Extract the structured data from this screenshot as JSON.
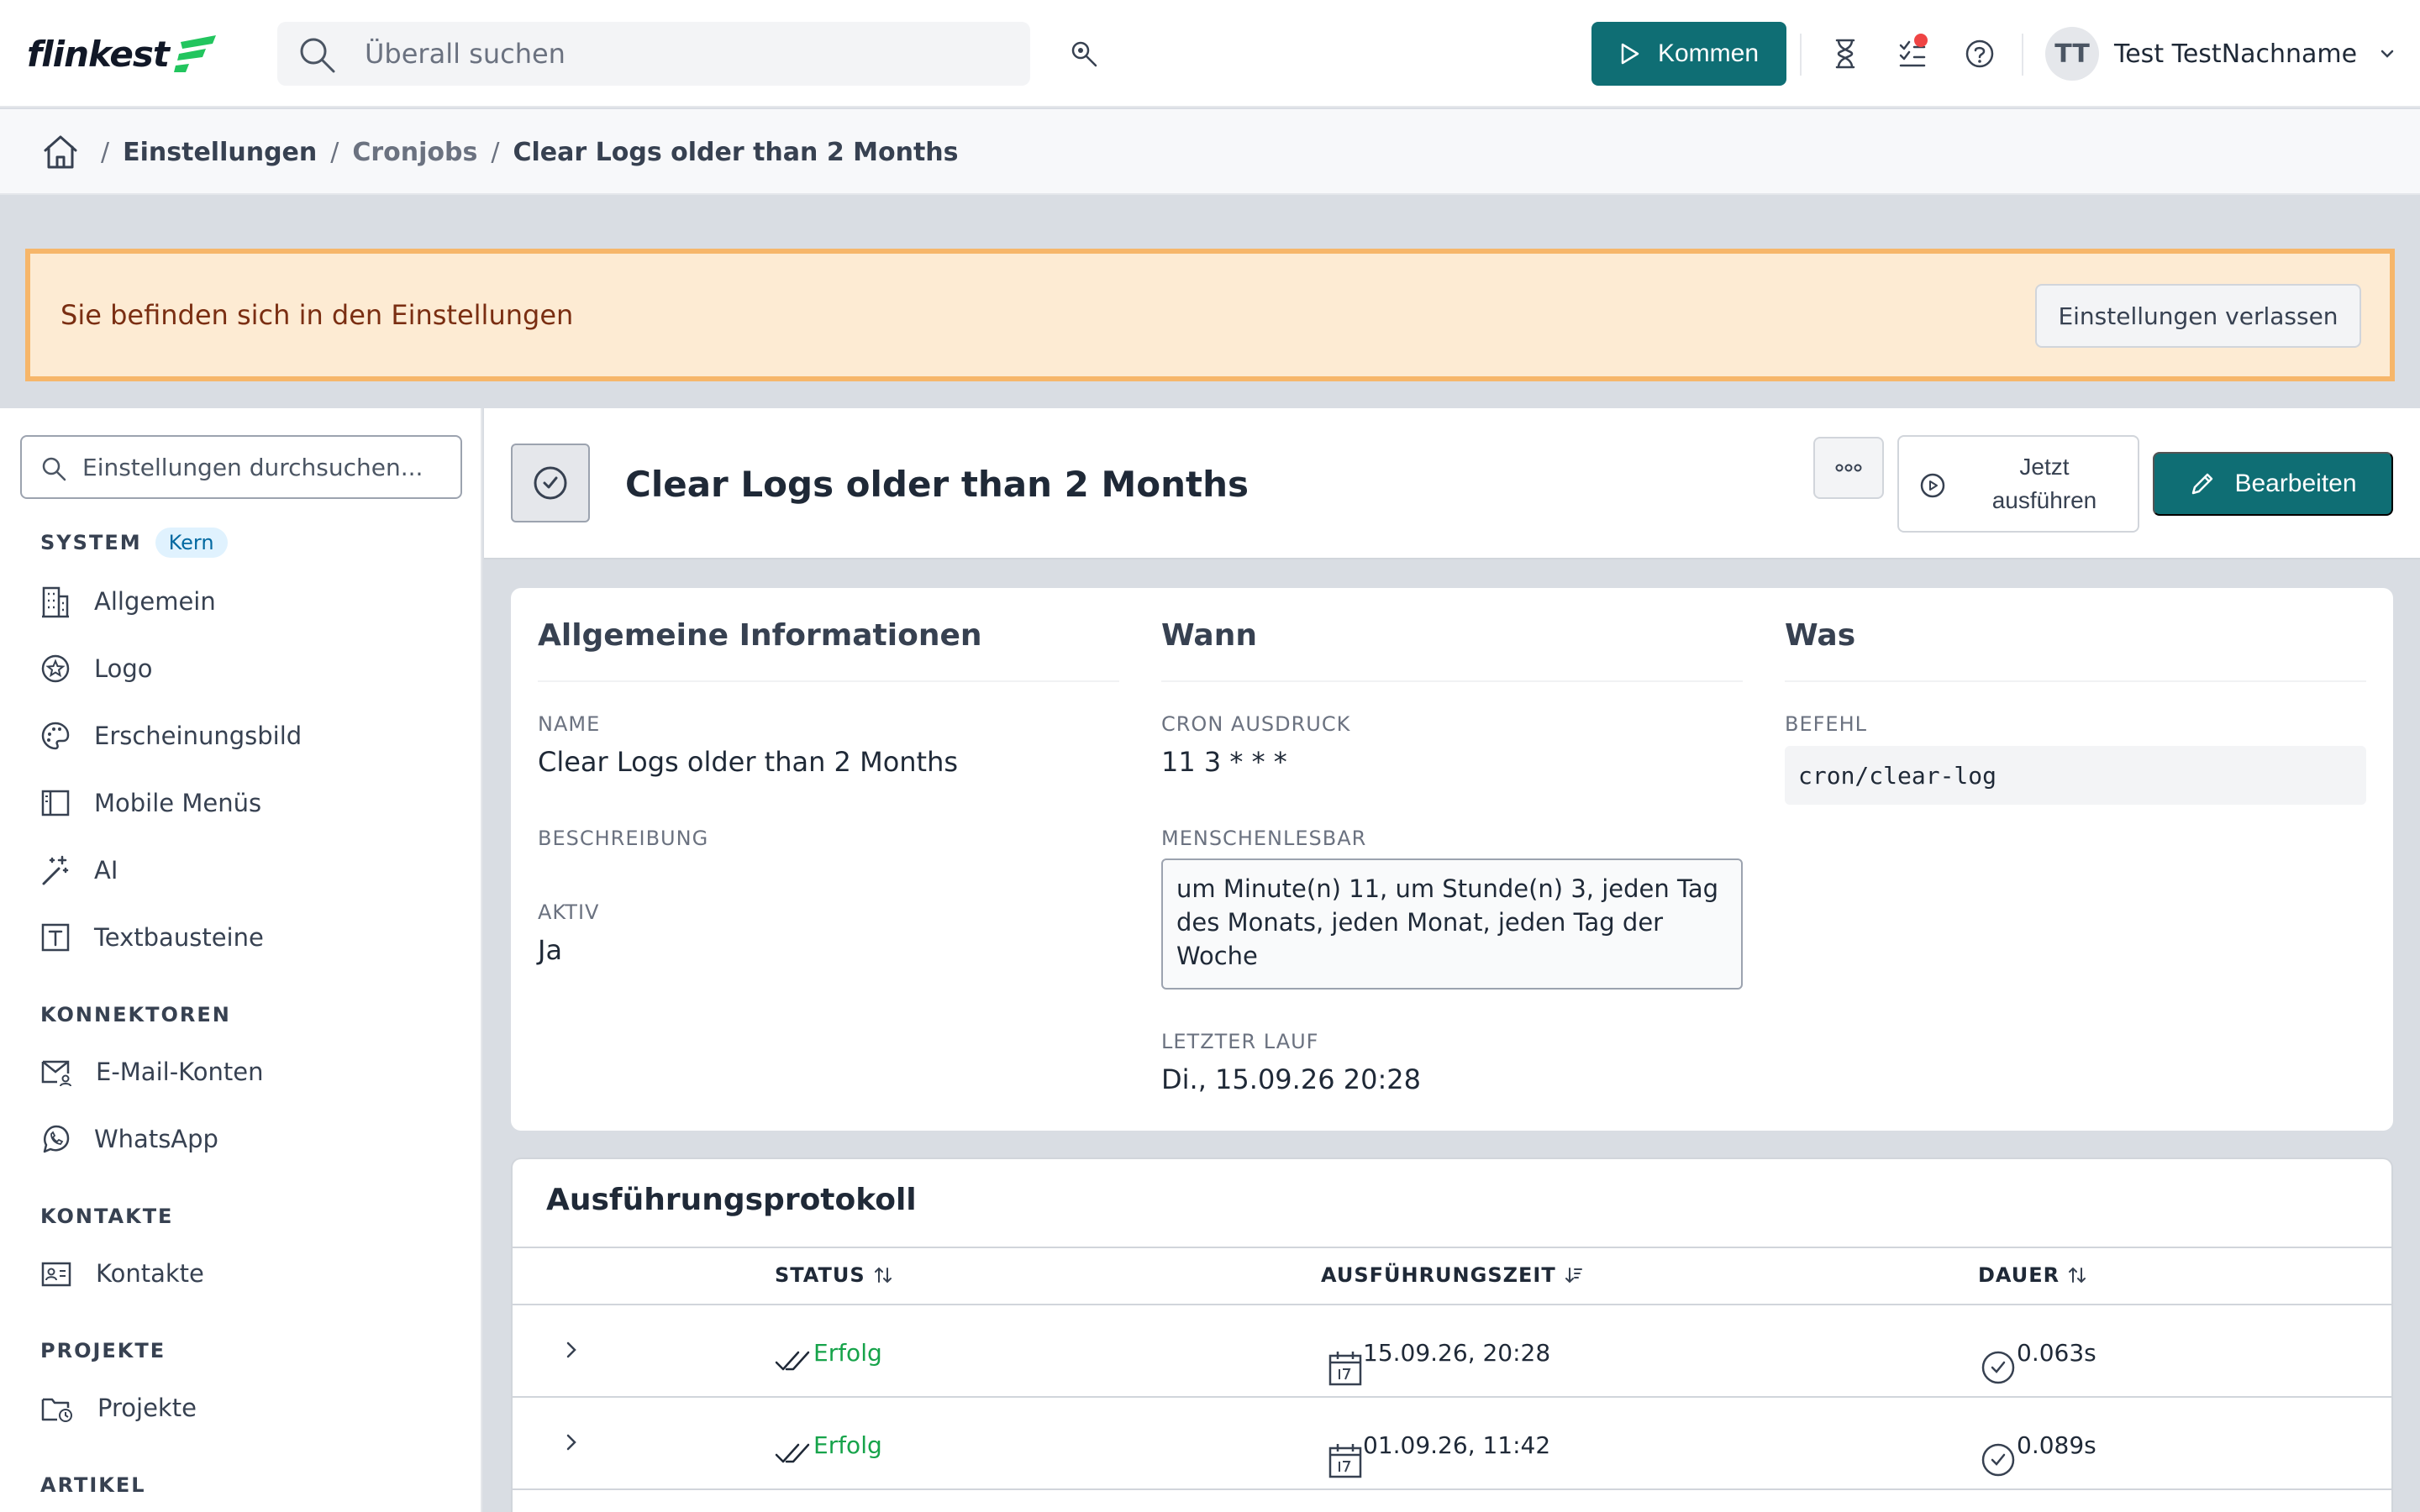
{
  "header": {
    "logo_text": "flinkest",
    "search_placeholder": "Überall suchen",
    "kommen_label": "Kommen",
    "user_initials": "TT",
    "user_name": "Test TestNachname",
    "accent_color": "#0f6e74"
  },
  "breadcrumb": {
    "items": [
      "Einstellungen",
      "Cronjobs",
      "Clear Logs older than 2 Months"
    ]
  },
  "notice": {
    "text": "Sie befinden sich in den Einstellungen",
    "button": "Einstellungen verlassen"
  },
  "sidebar": {
    "search_placeholder": "Einstellungen durchsuchen...",
    "sections": [
      {
        "title": "SYSTEM",
        "badge": "Kern"
      },
      {
        "title": "KONNEKTOREN"
      },
      {
        "title": "KONTAKTE"
      },
      {
        "title": "PROJEKTE"
      },
      {
        "title": "ARTIKEL"
      }
    ],
    "items": [
      {
        "label": "Allgemein",
        "icon": "building-icon"
      },
      {
        "label": "Logo",
        "icon": "star-badge-icon"
      },
      {
        "label": "Erscheinungsbild",
        "icon": "palette-icon"
      },
      {
        "label": "Mobile Menüs",
        "icon": "panel-icon"
      },
      {
        "label": "AI",
        "icon": "magic-wand-icon"
      },
      {
        "label": "Textbausteine",
        "icon": "text-block-icon"
      },
      {
        "label": "E-Mail-Konten",
        "icon": "mail-user-icon"
      },
      {
        "label": "WhatsApp",
        "icon": "whatsapp-icon"
      },
      {
        "label": "Kontakte",
        "icon": "contact-card-icon"
      },
      {
        "label": "Projekte",
        "icon": "folder-clock-icon"
      }
    ]
  },
  "job": {
    "title": "Clear Logs older than 2 Months",
    "run_label": "Jetzt ausführen",
    "edit_label": "Bearbeiten"
  },
  "info": {
    "general": {
      "title": "Allgemeine Informationen",
      "name_label": "NAME",
      "name_value": "Clear Logs older than 2 Months",
      "description_label": "BESCHREIBUNG",
      "active_label": "AKTIV",
      "active_value": "Ja"
    },
    "when": {
      "title": "Wann",
      "cron_label": "CRON AUSDRUCK",
      "cron_value": "11 3 * * *",
      "human_label": "MENSCHENLESBAR",
      "human_value": "um Minute(n) 11, um Stunde(n) 3, jeden Tag des Monats, jeden Monat, jeden Tag der Woche",
      "last_run_label": "LETZTER LAUF",
      "last_run_value": "Di., 15.09.26 20:28"
    },
    "what": {
      "title": "Was",
      "command_label": "BEFEHL",
      "command_value": "cron/clear-log"
    }
  },
  "log": {
    "title": "Ausführungsprotokoll",
    "columns": [
      "STATUS",
      "AUSFÜHRUNGSZEIT",
      "DAUER"
    ],
    "rows": [
      {
        "status": "Erfolg",
        "time": "15.09.26, 20:28",
        "duration": "0.063s"
      },
      {
        "status": "Erfolg",
        "time": "01.09.26, 11:42",
        "duration": "0.089s"
      }
    ],
    "success_color": "#16a34a"
  }
}
